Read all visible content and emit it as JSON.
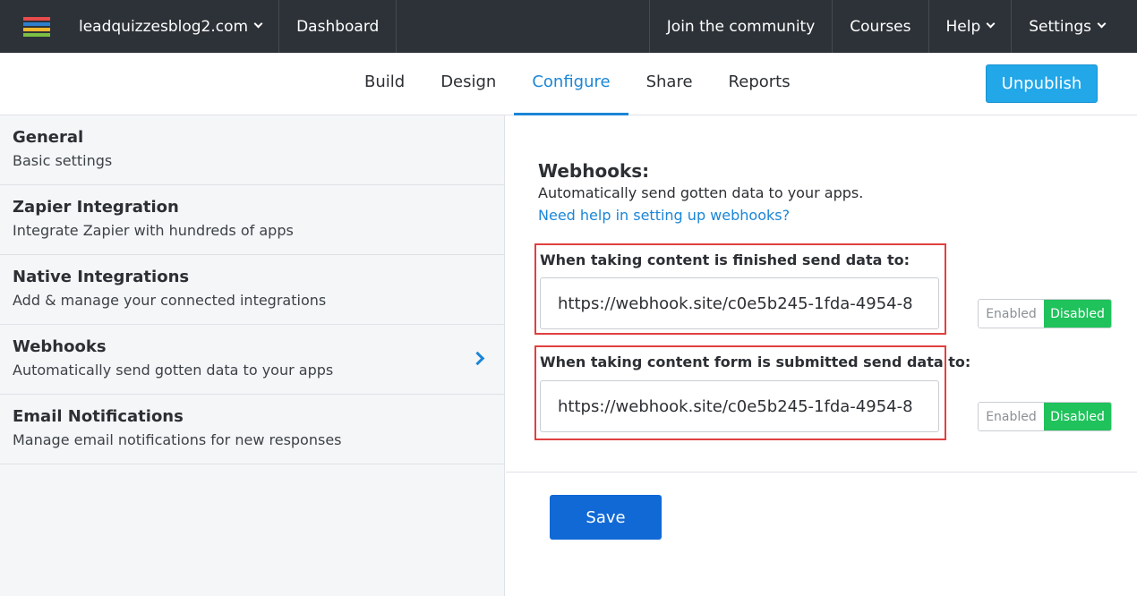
{
  "topbar": {
    "logo_colors": [
      "#e84b4b",
      "#2f7fcf",
      "#f2b82e",
      "#7bc043"
    ],
    "site": "leadquizzesblog2.com",
    "dashboard": "Dashboard",
    "community": "Join the community",
    "courses": "Courses",
    "help": "Help",
    "settings": "Settings"
  },
  "tabs": {
    "items": [
      "Build",
      "Design",
      "Configure",
      "Share",
      "Reports"
    ],
    "active": "Configure",
    "unpublish_label": "Unpublish"
  },
  "sidebar": {
    "items": [
      {
        "title": "General",
        "subtitle": "Basic settings"
      },
      {
        "title": "Zapier Integration",
        "subtitle": "Integrate Zapier with hundreds of apps"
      },
      {
        "title": "Native Integrations",
        "subtitle": "Add & manage your connected integrations"
      },
      {
        "title": "Webhooks",
        "subtitle": "Automatically send gotten data to your apps",
        "selected": true
      },
      {
        "title": "Email Notifications",
        "subtitle": "Manage email notifications for new responses"
      }
    ]
  },
  "webhooks": {
    "title": "Webhooks:",
    "description": "Automatically send gotten data to your apps.",
    "help_link": "Need help in setting up webhooks?",
    "fields": [
      {
        "label": "When taking content is finished send data to:",
        "value": "https://webhook.site/c0e5b245-1fda-4954-8",
        "toggle_enabled": "Enabled",
        "toggle_disabled": "Disabled",
        "state": "Disabled"
      },
      {
        "label": "When taking content form is submitted send data to:",
        "value": "https://webhook.site/c0e5b245-1fda-4954-8",
        "toggle_enabled": "Enabled",
        "toggle_disabled": "Disabled",
        "state": "Disabled"
      }
    ],
    "save_label": "Save"
  },
  "colors": {
    "accent": "#1b86d6",
    "topbar_bg": "#2d3238",
    "unpublish_bg": "#22a7e8",
    "disabled_active": "#1fc25b",
    "highlight_border": "#e04040",
    "save_bg": "#1169d6"
  }
}
